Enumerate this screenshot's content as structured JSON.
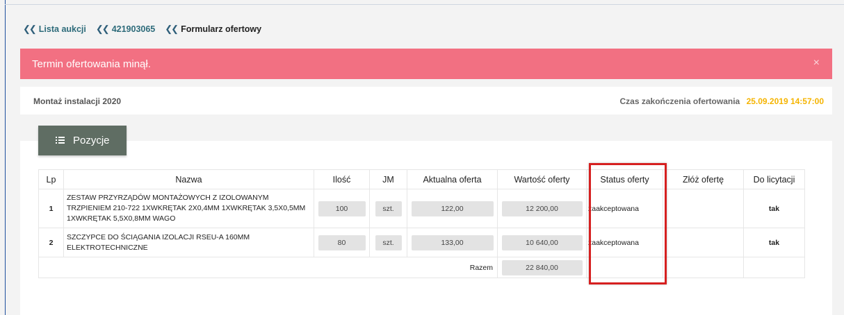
{
  "breadcrumb": [
    {
      "label": "Lista aukcji",
      "type": "link"
    },
    {
      "label": "421903065",
      "type": "link"
    },
    {
      "label": "Formularz ofertowy",
      "type": "current"
    }
  ],
  "alert": {
    "message": "Termin ofertowania minął.",
    "close_symbol": "×",
    "color": "#f27082"
  },
  "info": {
    "auction_name": "Montaż instalacji 2020",
    "deadline_label": "Czas zakończenia ofertowania",
    "deadline_value": "25.09.2019 14:57:00"
  },
  "tab": {
    "label": "Pozycje",
    "icon": "list-icon"
  },
  "table": {
    "headers": [
      "Lp",
      "Nazwa",
      "Ilość",
      "JM",
      "Aktualna oferta",
      "Wartość oferty",
      "Status oferty",
      "Złóż ofertę",
      "Do licytacji"
    ],
    "rows": [
      {
        "lp": "1",
        "name": "ZESTAW PRZYRZĄDÓW MONTAŻOWYCH Z IZOLOWANYM TRZPIENIEM 210-722 1XWKRĘTAK 2X0,4MM 1XWKRĘTAK 3,5X0,5MM 1XWKRĘTAK 5,5X0,8MM WAGO",
        "qty": "100",
        "unit": "szt.",
        "current_offer": "122,00",
        "offer_value": "12 200,00",
        "status": "zaakceptowana",
        "licytacja": "tak"
      },
      {
        "lp": "2",
        "name": "SZCZYPCE DO ŚCIĄGANIA IZOLACJI RSEU-A 160MM ELEKTROTECHNICZNE",
        "qty": "80",
        "unit": "szt.",
        "current_offer": "133,00",
        "offer_value": "10 640,00",
        "status": "zaakceptowana",
        "licytacja": "tak"
      }
    ],
    "total_label": "Razem",
    "total_value": "22 840,00"
  },
  "colors": {
    "accent_status": "#4cb98a",
    "deadline": "#f5b400",
    "highlight": "#d62020",
    "tab_bg": "#5f6d63"
  }
}
